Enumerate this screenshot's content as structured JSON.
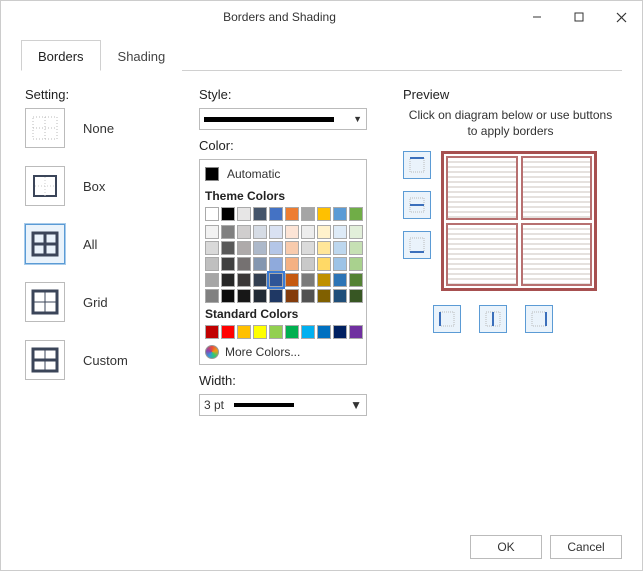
{
  "window": {
    "title": "Borders and Shading"
  },
  "tabs": [
    {
      "label": "Borders"
    },
    {
      "label": "Shading"
    }
  ],
  "active_tab": 0,
  "setting": {
    "heading": "Setting:",
    "options": [
      {
        "label": "None"
      },
      {
        "label": "Box"
      },
      {
        "label": "All"
      },
      {
        "label": "Grid"
      },
      {
        "label": "Custom"
      }
    ],
    "selected": "All"
  },
  "style": {
    "heading": "Style:"
  },
  "color": {
    "heading": "Color:",
    "automatic_label": "Automatic",
    "theme_label": "Theme Colors",
    "theme_main": [
      "#ffffff",
      "#000000",
      "#e7e6e6",
      "#44546a",
      "#4472c4",
      "#ed7d31",
      "#a5a5a5",
      "#ffc000",
      "#5b9bd5",
      "#70ad47"
    ],
    "theme_shades": [
      [
        "#f2f2f2",
        "#808080",
        "#d0cece",
        "#d6dce5",
        "#d9e1f2",
        "#fce4d6",
        "#ededed",
        "#fff2cc",
        "#deebf7",
        "#e2efda"
      ],
      [
        "#d9d9d9",
        "#595959",
        "#aeaaaa",
        "#adb9ca",
        "#b4c6e7",
        "#f8cbad",
        "#dbdbdb",
        "#ffe699",
        "#bdd7ee",
        "#c6e0b4"
      ],
      [
        "#bfbfbf",
        "#404040",
        "#757171",
        "#8497b0",
        "#8faadc",
        "#f4b183",
        "#c9c9c9",
        "#ffd966",
        "#9dc3e6",
        "#a9d18e"
      ],
      [
        "#a6a6a6",
        "#262626",
        "#3b3838",
        "#333f50",
        "#2f5597",
        "#c55a11",
        "#7b7b7b",
        "#bf9000",
        "#2e75b6",
        "#548235"
      ],
      [
        "#808080",
        "#0d0d0d",
        "#171717",
        "#222a35",
        "#1f3864",
        "#843c0c",
        "#525252",
        "#806000",
        "#1f4e79",
        "#375623"
      ]
    ],
    "standard_label": "Standard Colors",
    "standard": [
      "#c00000",
      "#ff0000",
      "#ffc000",
      "#ffff00",
      "#92d050",
      "#00b050",
      "#00b0f0",
      "#0070c0",
      "#002060",
      "#7030a0"
    ],
    "selected": "#2f5597",
    "more_label": "More Colors..."
  },
  "width": {
    "heading": "Width:",
    "value": "3 pt"
  },
  "preview": {
    "heading": "Preview",
    "hint": "Click on diagram below or use buttons to apply  borders",
    "border_color": "#a75050"
  },
  "footer": {
    "ok": "OK",
    "cancel": "Cancel"
  }
}
